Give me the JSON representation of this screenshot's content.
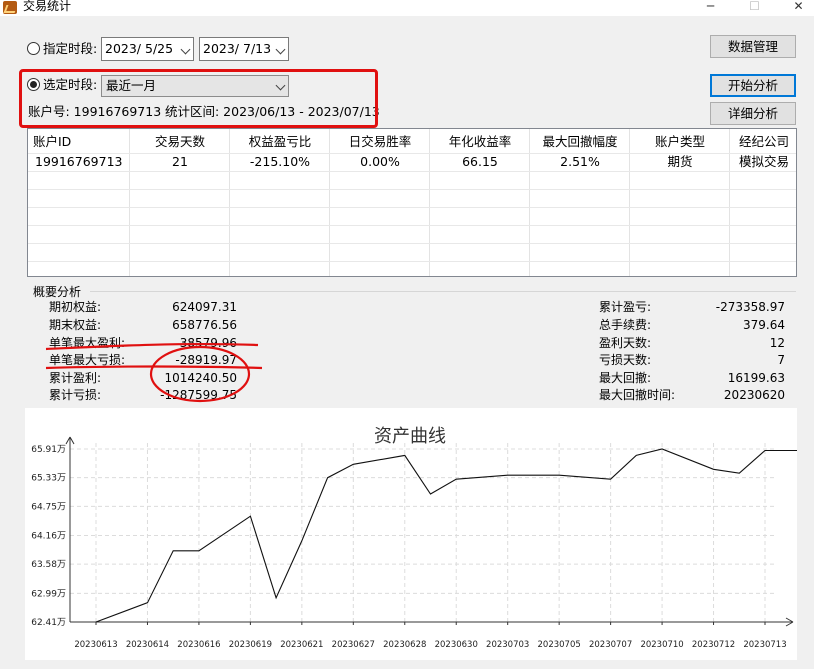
{
  "window": {
    "title": "交易统计",
    "min_glyph": "─",
    "max_glyph": "☐",
    "close_glyph": "✕"
  },
  "period": {
    "custom_label": "指定时段:",
    "start_date": "2023/  5/25",
    "end_date": "2023/  7/13",
    "preset_label": "选定时段:",
    "preset_value": "最近一月",
    "account_text": "账户号: 19916769713",
    "range_text": "统计区间: 2023/06/13 - 2023/07/13"
  },
  "buttons": {
    "data_manage": "数据管理",
    "start_analysis": "开始分析",
    "detail_analysis": "详细分析"
  },
  "table": {
    "columns": [
      "账户ID",
      "交易天数",
      "权益盈亏比",
      "日交易胜率",
      "年化收益率",
      "最大回撤幅度",
      "账户类型",
      "经纪公司"
    ],
    "rows": [
      [
        "19916769713",
        "21",
        "-215.10%",
        "0.00%",
        "66.15",
        "2.51%",
        "期货",
        "模拟交易"
      ]
    ]
  },
  "summary": {
    "title": "概要分析",
    "left": [
      {
        "label": "期初权益:",
        "value": "624097.31"
      },
      {
        "label": "期末权益:",
        "value": "658776.56"
      },
      {
        "label": "单笔最大盈利:",
        "value": "38579.96"
      },
      {
        "label": "单笔最大亏损:",
        "value": "-28919.97"
      },
      {
        "label": "累计盈利:",
        "value": "1014240.50"
      },
      {
        "label": "累计亏损:",
        "value": "-1287599.75"
      }
    ],
    "right": [
      {
        "label": "累计盈亏:",
        "value": "-273358.97"
      },
      {
        "label": "总手续费:",
        "value": "379.64"
      },
      {
        "label": "盈利天数:",
        "value": "12"
      },
      {
        "label": "亏损天数:",
        "value": "7"
      },
      {
        "label": "最大回撤:",
        "value": "16199.63"
      },
      {
        "label": "最大回撤时间:",
        "value": "20230620"
      }
    ]
  },
  "colors": {
    "annotation_red": "#e01010",
    "accent_blue": "#0078d7"
  },
  "chart_data": {
    "type": "line",
    "title": "资产曲线",
    "y_tick_labels": [
      "62.41万",
      "62.99万",
      "63.58万",
      "64.16万",
      "64.75万",
      "65.33万",
      "65.91万"
    ],
    "y_ticks": [
      62.41,
      62.99,
      63.58,
      64.16,
      64.75,
      65.33,
      65.91
    ],
    "ylim": [
      62.41,
      65.91
    ],
    "unit": "万",
    "categories": [
      "20230613",
      "20230614",
      "20230616",
      "20230619",
      "20230621",
      "20230627",
      "20230628",
      "20230630",
      "20230703",
      "20230705",
      "20230707",
      "20230710",
      "20230712",
      "20230713"
    ],
    "series": [
      {
        "x": [
          0,
          1,
          1.5,
          2,
          3,
          3.5,
          4,
          4.5,
          5,
          6,
          6.5,
          7,
          8,
          9,
          10,
          10.5,
          11,
          12,
          12.5,
          13,
          14
        ],
        "values": [
          62.41,
          62.8,
          63.85,
          63.85,
          64.55,
          62.9,
          64.05,
          65.33,
          65.6,
          65.78,
          65.0,
          65.3,
          65.38,
          65.38,
          65.3,
          65.78,
          65.91,
          65.5,
          65.42,
          65.88,
          65.88
        ]
      }
    ]
  }
}
